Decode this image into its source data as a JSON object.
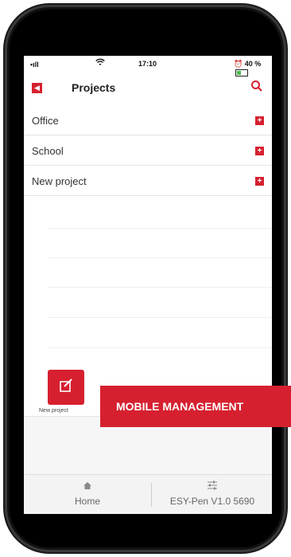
{
  "status_bar": {
    "signal": "•ıll",
    "time": "17:10",
    "battery": "40 %"
  },
  "header": {
    "title": "Projects",
    "back_icon": "chevron-left-icon",
    "search_icon": "search-icon"
  },
  "projects": [
    {
      "label": "Office"
    },
    {
      "label": "School"
    },
    {
      "label": "New project"
    }
  ],
  "new_project_button": {
    "label": "New project"
  },
  "bottom_nav": {
    "home_label": "Home",
    "device_label": "ESY-Pen V1.0 5690"
  },
  "banner": {
    "text": "MOBILE MANAGEMENT"
  },
  "colors": {
    "accent": "#d6202f"
  }
}
